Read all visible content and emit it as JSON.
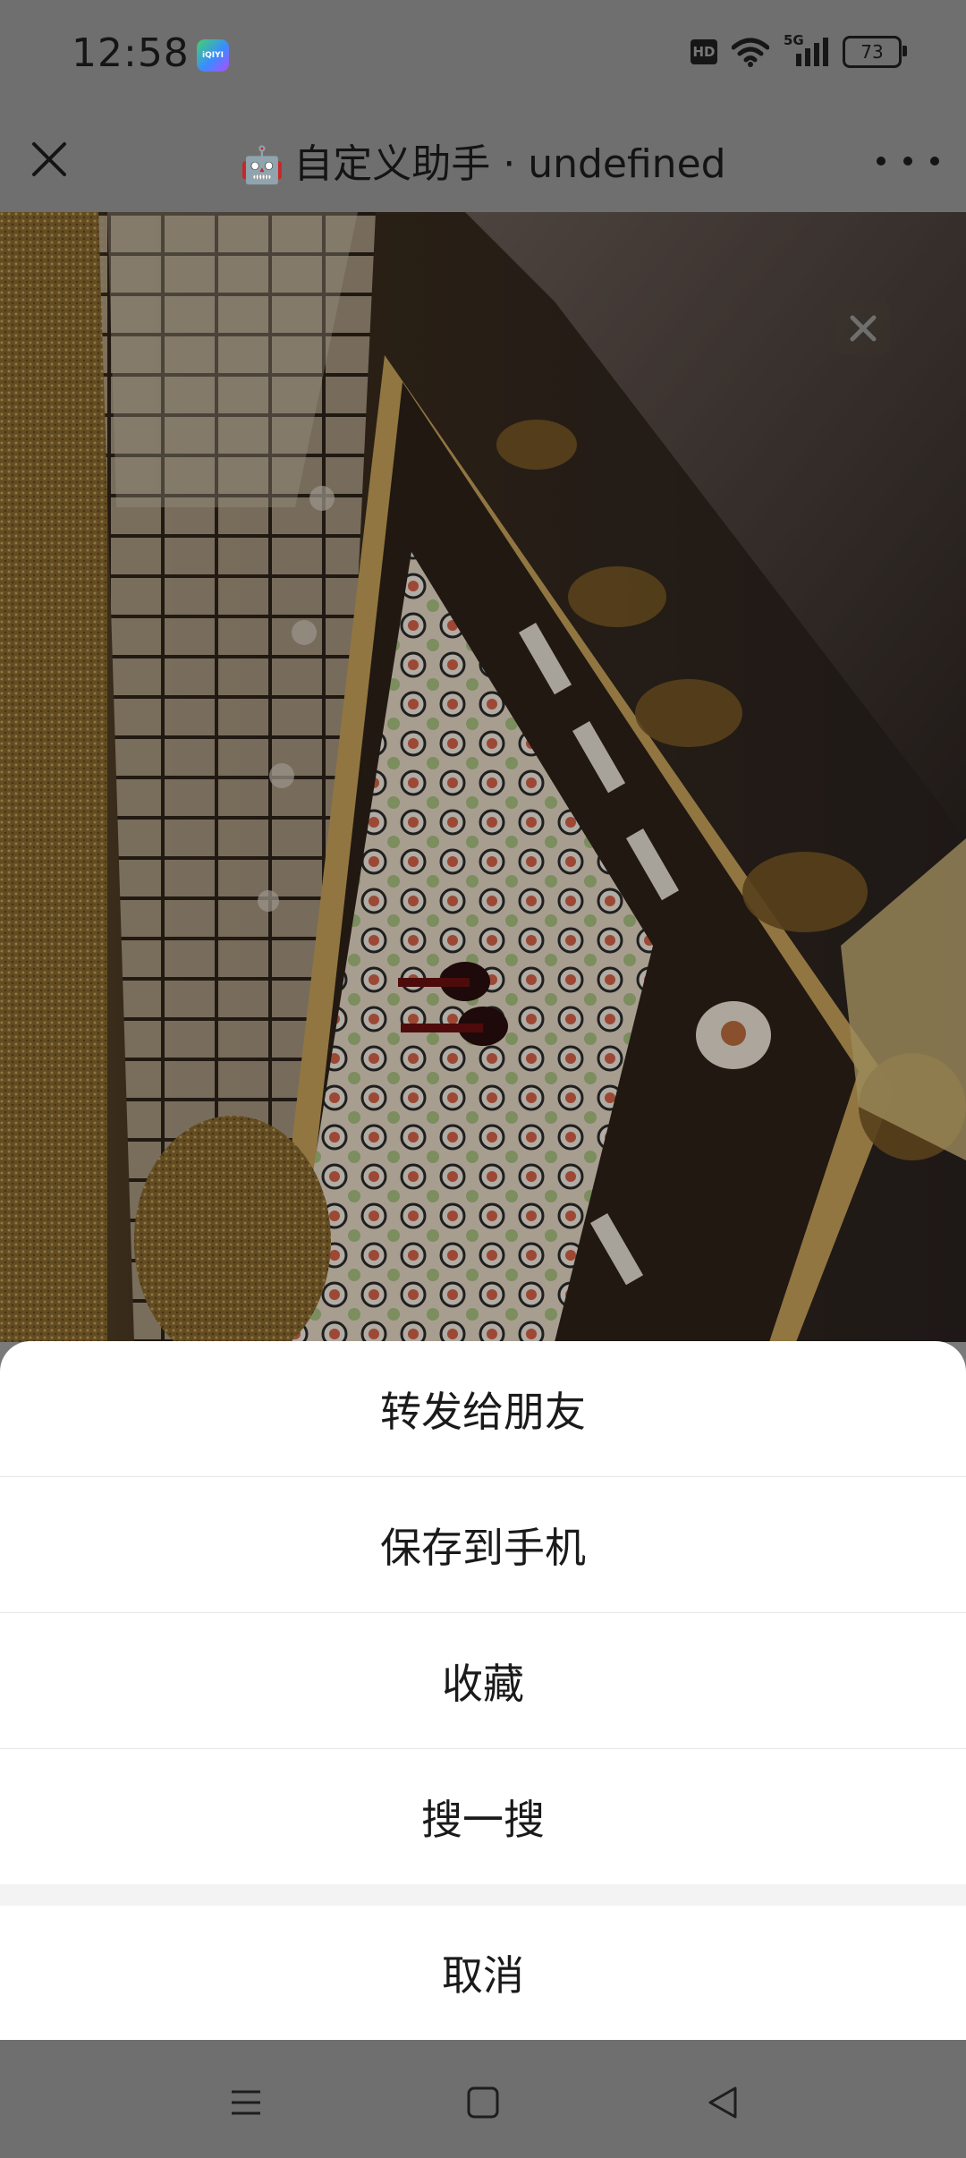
{
  "status_bar": {
    "time": "12:58",
    "app_badge": "iQIYI",
    "hd": "HD",
    "network": "5G",
    "battery": "73"
  },
  "title_bar": {
    "robot_emoji": "🤖",
    "title": "自定义助手 · undefined"
  },
  "preview": {
    "description_icon": "image-close-icon"
  },
  "action_sheet": {
    "forward": "转发给朋友",
    "save": "保存到手机",
    "favorite": "收藏",
    "search": "搜一搜",
    "cancel": "取消"
  },
  "colors": {
    "overlay_gray": "#6f6f6f",
    "sheet_bg": "#ffffff",
    "text": "#1a1a1a"
  }
}
